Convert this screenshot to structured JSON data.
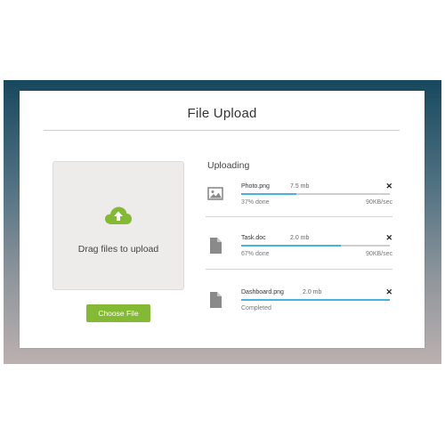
{
  "colors": {
    "accent": "#84b934",
    "progress": "#45b2e0",
    "backdrop": "#17485e"
  },
  "header": {
    "title": "File Upload"
  },
  "dropzone": {
    "icon": "cloud-upload-icon",
    "text": "Drag files to upload"
  },
  "choose_button": {
    "label": "Choose File"
  },
  "uploads": {
    "heading": "Uploading",
    "files": [
      {
        "icon": "image-file-icon",
        "name": "Photo.png",
        "size": "7.5 mb",
        "progress": 0.37,
        "status": "37% done",
        "speed": "90KB/sec"
      },
      {
        "icon": "document-file-icon",
        "name": "Task.doc",
        "size": "2.0 mb",
        "progress": 0.67,
        "status": "67% done",
        "speed": "90KB/sec"
      },
      {
        "icon": "document-file-icon",
        "name": "Dashboard.png",
        "size": "2.0 mb",
        "progress": 1.0,
        "status": "Completed",
        "speed": ""
      }
    ]
  }
}
